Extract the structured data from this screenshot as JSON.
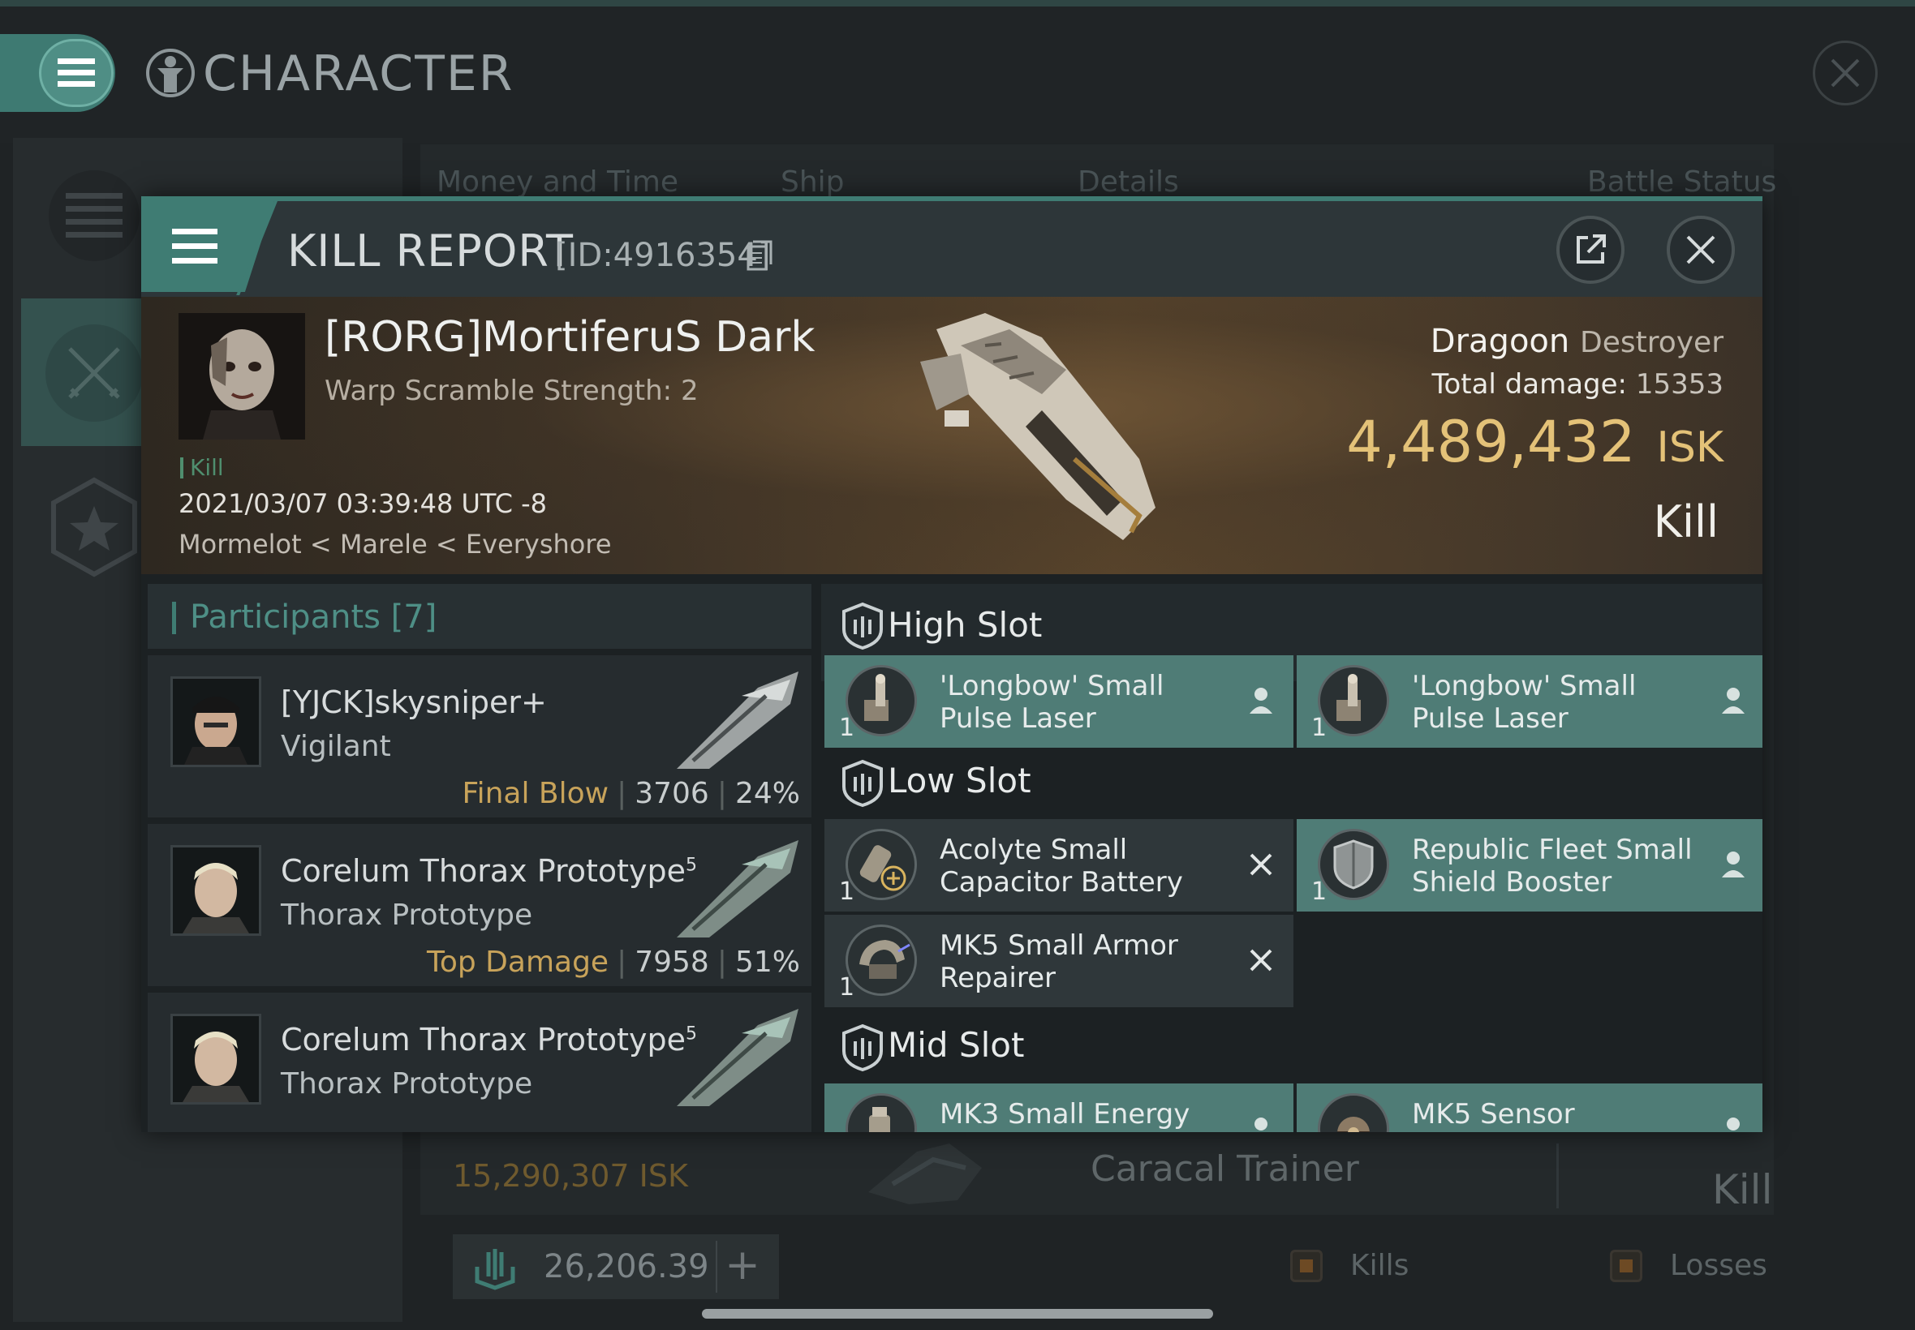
{
  "window": {
    "title": "CHARACTER",
    "columns": [
      "Money and Time",
      "Ship",
      "Details",
      "Battle Status"
    ],
    "bg_row": {
      "isk": "15,290,307 ISK",
      "ship": "Caracal Trainer",
      "result": "Kill"
    },
    "wallet": {
      "value": "26,206.39"
    },
    "legend": [
      {
        "label": "Kills"
      },
      {
        "label": "Losses"
      }
    ]
  },
  "kill_report": {
    "title": "KILL REPORT",
    "id_label": "[ID:4916354]",
    "pilot": "[RORG]MortiferuS Dark",
    "warp_scramble": "Warp Scramble Strength: 2",
    "tag": "Kill",
    "datetime": "2021/03/07 03:39:48 UTC -8",
    "location": "Mormelot < Marele < Everyshore",
    "ship_name": "Dragoon",
    "ship_class": "Destroyer",
    "damage_label": "Total damage:",
    "damage_value": "15353",
    "isk_value": "4,489,432",
    "isk_unit": "ISK",
    "result": "Kill",
    "colors": {
      "accent": "#3f7c73",
      "isk": "#e4c278",
      "fitted": "#4f7c76",
      "dropped": "#2f373a"
    }
  },
  "participants": {
    "header": "Participants [7]",
    "rows": [
      {
        "name": "[YJCK]skysniper+",
        "sup": "",
        "ship": "Vigilant",
        "label": "Final Blow",
        "damage": "3706",
        "percent": "24%"
      },
      {
        "name": "Corelum Thorax Prototype",
        "sup": "5",
        "ship": "Thorax Prototype",
        "label": "Top Damage",
        "damage": "7958",
        "percent": "51%"
      },
      {
        "name": "Corelum Thorax Prototype",
        "sup": "5",
        "ship": "Thorax Prototype"
      }
    ]
  },
  "slots": {
    "high": {
      "title": "High Slot",
      "items": [
        {
          "qty": "1",
          "name": "'Longbow' Small Pulse Laser",
          "status": "fitted",
          "icon": "pulse-laser-icon",
          "mark": "person-icon"
        },
        {
          "qty": "1",
          "name": "'Longbow' Small Pulse Laser",
          "status": "fitted",
          "icon": "pulse-laser-icon",
          "mark": "person-icon"
        }
      ]
    },
    "low": {
      "title": "Low Slot",
      "items": [
        {
          "qty": "1",
          "name": "Acolyte Small Capacitor Battery",
          "status": "destroyed",
          "icon": "capacitor-battery-icon",
          "mark": "x-icon"
        },
        {
          "qty": "1",
          "name": "Republic Fleet Small Shield Booster",
          "status": "fitted",
          "icon": "shield-booster-icon",
          "mark": "person-icon"
        },
        {
          "qty": "1",
          "name": "MK5 Small Armor Repairer",
          "status": "destroyed",
          "icon": "armor-repairer-icon",
          "mark": "x-icon"
        }
      ]
    },
    "mid": {
      "title": "Mid Slot",
      "items": [
        {
          "name": "MK3 Small Energy",
          "status": "fitted",
          "icon": "energy-module-icon",
          "mark": "person-icon"
        },
        {
          "name": "MK5 Sensor",
          "status": "fitted",
          "icon": "sensor-icon",
          "mark": "person-icon"
        }
      ]
    }
  }
}
